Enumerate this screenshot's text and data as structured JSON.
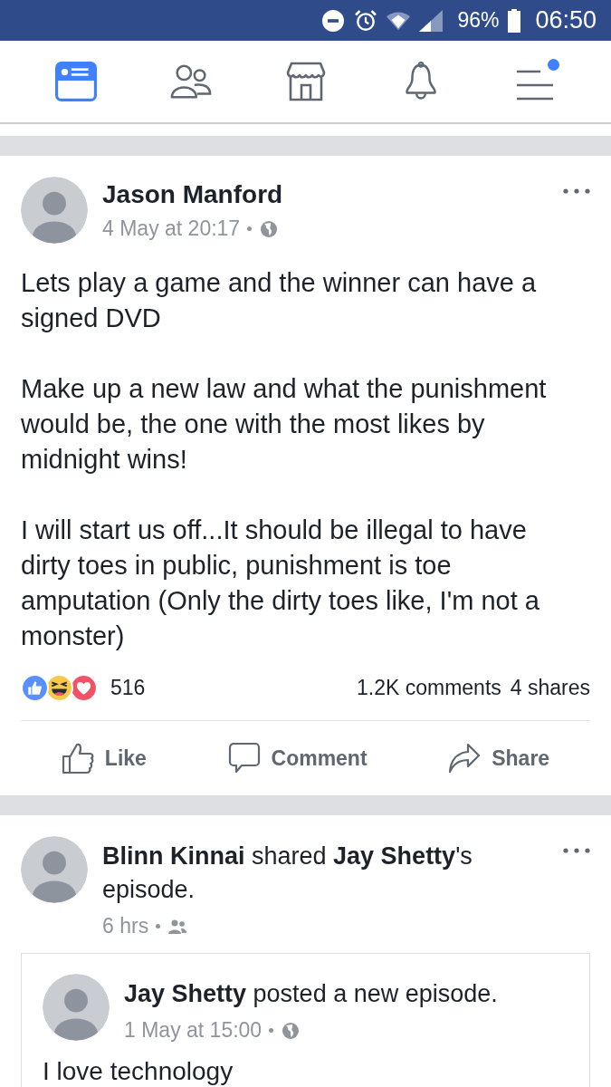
{
  "status_bar": {
    "battery": "96%",
    "time": "06:50"
  },
  "nav": {
    "tabs": [
      {
        "kind": "news-feed",
        "selected": true,
        "badge": false
      },
      {
        "kind": "friends",
        "selected": false,
        "badge": false
      },
      {
        "kind": "marketplace",
        "selected": false,
        "badge": false
      },
      {
        "kind": "notifications",
        "selected": false,
        "badge": false
      },
      {
        "kind": "menu",
        "selected": false,
        "badge": true
      }
    ]
  },
  "posts": [
    {
      "header": "Jason Manford",
      "time": "4 May at 20:17",
      "audience": {
        "kind": "public"
      },
      "paragraphs": [
        "Lets play a game and the winner can have a signed DVD",
        "Make up a new law and what the punishment would be, the one with the most likes by midnight wins!",
        "I will start us off...It should be illegal to have dirty toes in public, punishment is toe amputation (Only the dirty toes like, I'm not a monster)"
      ],
      "reactions": [
        {
          "kind": "like"
        },
        {
          "kind": "haha"
        },
        {
          "kind": "love"
        }
      ],
      "reaction_count": "516",
      "comments": "1.2K comments",
      "shares": "4 shares",
      "actions": [
        {
          "kind": "like",
          "label": "Like"
        },
        {
          "kind": "comment",
          "label": "Comment"
        },
        {
          "kind": "share",
          "label": "Share"
        }
      ]
    },
    {
      "header": "**Blinn Kinnai** shared **Jay Shetty**'s episode.",
      "time": "6 hrs",
      "audience": {
        "kind": "friends"
      },
      "shared": {
        "header": "**Jay Shetty** posted a new episode.",
        "time": "1 May at 15:00",
        "audience": {
          "kind": "public"
        },
        "text": "I love technology"
      }
    }
  ]
}
